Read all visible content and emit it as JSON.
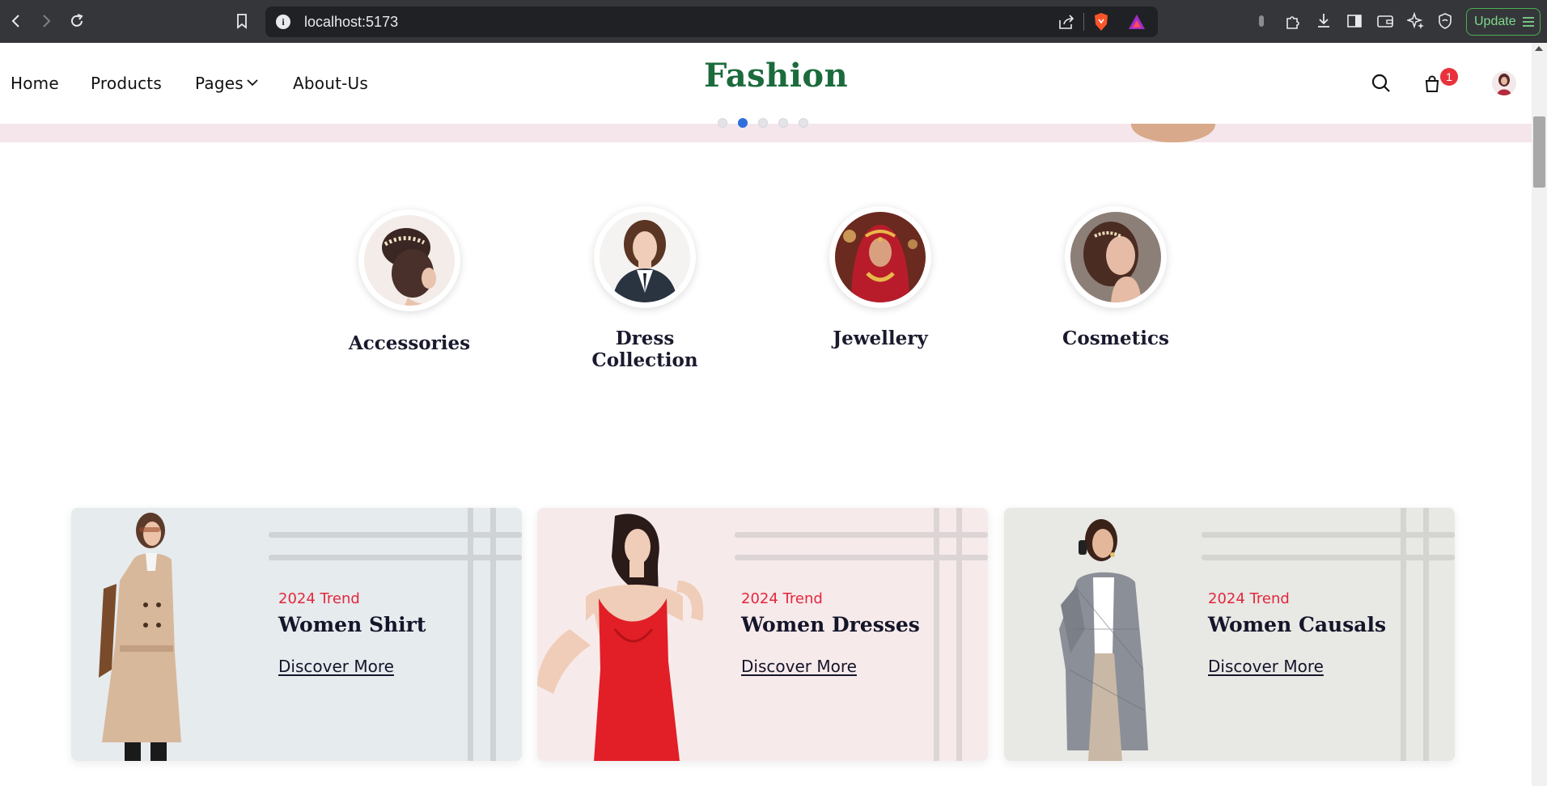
{
  "browser": {
    "url": "localhost:5173",
    "update_label": "Update",
    "accent": "#4caf50"
  },
  "header": {
    "nav": [
      "Home",
      "Products",
      "Pages",
      "About-Us"
    ],
    "brand": "Fashion",
    "brand_color": "#1c6b3d",
    "cart_count": "1",
    "badge_color": "#e8323c"
  },
  "hero": {
    "background": "#f5e6ec",
    "slides": 5,
    "active_slide": 2
  },
  "categories": [
    {
      "label": "Accessories"
    },
    {
      "label": "Dress Collection"
    },
    {
      "label": "Jewellery"
    },
    {
      "label": "Cosmetics"
    }
  ],
  "promos": [
    {
      "trend": "2024 Trend",
      "title": "Women Shirt",
      "cta": "Discover More",
      "background": "#e6ebee"
    },
    {
      "trend": "2024 Trend",
      "title": "Women Dresses",
      "cta": "Discover More",
      "background": "#f7eaeb"
    },
    {
      "trend": "2024 Trend",
      "title": "Women Causals",
      "cta": "Discover More",
      "background": "#e8e8e5"
    }
  ],
  "colors": {
    "trend_red": "#e3273b",
    "heading_navy": "#15152a"
  }
}
